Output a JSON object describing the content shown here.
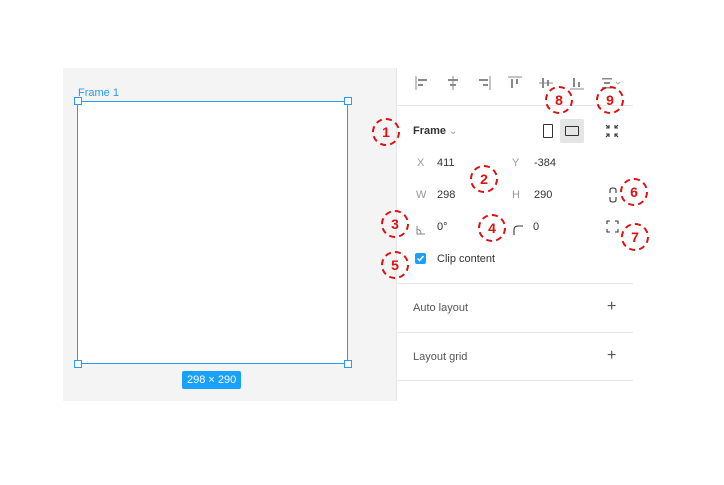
{
  "canvas": {
    "frame_label": "Frame 1",
    "size_badge": "298 × 290"
  },
  "panel": {
    "frame_title": "Frame",
    "frame_title_chevron": "⌄",
    "x_label": "X",
    "x_value": "411",
    "y_label": "Y",
    "y_value": "-384",
    "w_label": "W",
    "w_value": "298",
    "h_label": "H",
    "h_value": "290",
    "rotation_value": "0°",
    "radius_value": "0",
    "clip_content_label": "Clip content",
    "clip_content_checked": true,
    "auto_layout_label": "Auto layout",
    "layout_grid_label": "Layout grid",
    "plus_glyph": "+"
  },
  "align_icons": [
    "align-left-icon",
    "align-horizontal-center-icon",
    "align-right-icon",
    "align-top-icon",
    "align-vertical-center-icon",
    "align-bottom-icon",
    "distribute-icon"
  ],
  "callouts": [
    "1",
    "2",
    "3",
    "4",
    "5",
    "6",
    "7",
    "8",
    "9"
  ],
  "colors": {
    "selection_blue": "#2a9bf0",
    "badge_blue": "#18a0fb",
    "callout_red": "#e01010"
  }
}
